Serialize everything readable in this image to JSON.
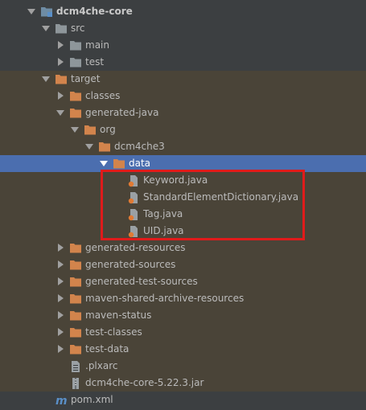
{
  "tree": {
    "module_label": "dcm4che-core",
    "src_label": "src",
    "main_label": "main",
    "test_label": "test",
    "target_label": "target",
    "classes_label": "classes",
    "generated_java_label": "generated-java",
    "org_label": "org",
    "dcm4che3_label": "dcm4che3",
    "data_label": "data",
    "files": [
      "Keyword.java",
      "StandardElementDictionary.java",
      "Tag.java",
      "UID.java"
    ],
    "generated_resources_label": "generated-resources",
    "generated_sources_label": "generated-sources",
    "generated_test_sources_label": "generated-test-sources",
    "maven_shared_label": "maven-shared-archive-resources",
    "maven_status_label": "maven-status",
    "test_classes_label": "test-classes",
    "test_data_label": "test-data",
    "plxarc_label": ".plxarc",
    "jar_label": "dcm4che-core-5.22.3.jar",
    "pom_label": "pom.xml"
  },
  "colors": {
    "background": "#3c3f41",
    "selection": "#4b6eaf",
    "target_tint": "#4a4438",
    "highlight_box": "#e01b1b",
    "excluded_folder": "#d2844c"
  }
}
